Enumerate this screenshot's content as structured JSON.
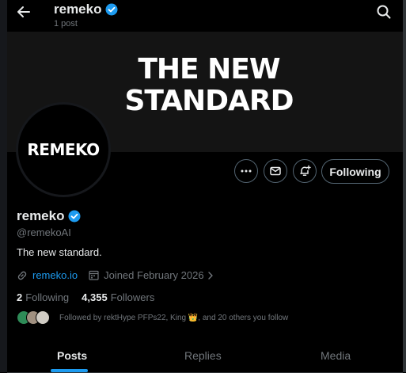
{
  "header": {
    "name": "remeko",
    "post_count": "1 post"
  },
  "banner": {
    "line1": "THE NEW",
    "line2": "STANDARD"
  },
  "avatar": {
    "text": "REMEKO"
  },
  "actions": {
    "follow_label": "Following"
  },
  "profile": {
    "name": "remeko",
    "handle": "@remekoAI",
    "bio": "The new standard.",
    "website": "remeko.io",
    "joined": "Joined February 2026"
  },
  "stats": {
    "following_count": "2",
    "following_label": "Following",
    "followers_count": "4,355",
    "followers_label": "Followers"
  },
  "followed_by": {
    "text": "Followed by rektHype PFPs22, King 👑, and 20 others you follow"
  },
  "tabs": [
    {
      "label": "Posts"
    },
    {
      "label": "Replies"
    },
    {
      "label": "Media"
    }
  ],
  "colors": {
    "accent": "#1d9bf0",
    "verified": "#1d9bf0",
    "background": "#000000",
    "muted_text": "#71767b"
  },
  "icons": [
    "back-arrow-icon",
    "search-icon",
    "verified-badge-icon",
    "more-icon",
    "mail-icon",
    "notification-add-icon",
    "link-icon",
    "calendar-icon",
    "chevron-right-icon"
  ]
}
